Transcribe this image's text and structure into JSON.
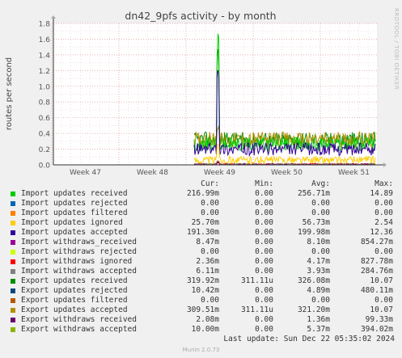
{
  "chart_data": {
    "type": "line",
    "title": "dn42_9pfs activity - by month",
    "ylabel": "routes per second",
    "ylim": [
      0,
      1.8
    ],
    "yticks": [
      "0.0",
      "0.2",
      "0.4",
      "0.6",
      "0.8",
      "1.0",
      "1.2",
      "1.4",
      "1.6",
      "1.8"
    ],
    "xticks": [
      "Week 47",
      "Week 48",
      "Week 49",
      "Week 50",
      "Week 51"
    ],
    "grid": true,
    "series": [
      {
        "name": "Import updates received",
        "color": "#00cc00",
        "level": 0.26,
        "noise": 0.09,
        "spike": 1.68
      },
      {
        "name": "Import updates rejected",
        "color": "#0066b3",
        "level": 0,
        "noise": 0,
        "spike": 0
      },
      {
        "name": "Import updates filtered",
        "color": "#ff8000",
        "level": 0,
        "noise": 0,
        "spike": 0
      },
      {
        "name": "Import updates ignored",
        "color": "#ffcc00",
        "level": 0.06,
        "noise": 0.05,
        "spike": 0.3
      },
      {
        "name": "Import updates accepted",
        "color": "#330099",
        "level": 0.2,
        "noise": 0.08,
        "spike": 1.3
      },
      {
        "name": "Import withdraws_received",
        "color": "#990099",
        "level": 0.008,
        "noise": 0.01,
        "spike": 0.05
      },
      {
        "name": "Import withdraws rejected",
        "color": "#ccff00",
        "level": 0,
        "noise": 0,
        "spike": 0
      },
      {
        "name": "Import withdraws ignored",
        "color": "#ff0000",
        "level": 0.004,
        "noise": 0.01,
        "spike": 0.04
      },
      {
        "name": "Import withdraws accepted",
        "color": "#808080",
        "level": 0.004,
        "noise": 0.006,
        "spike": 0.03
      },
      {
        "name": "Export updates received",
        "color": "#008f00",
        "level": 0.32,
        "noise": 0.1,
        "spike": 1.5
      },
      {
        "name": "Export updates rejected",
        "color": "#00487d",
        "level": 0.005,
        "noise": 0.01,
        "spike": 0.05
      },
      {
        "name": "Export updates filtered",
        "color": "#b35a00",
        "level": 0,
        "noise": 0,
        "spike": 0
      },
      {
        "name": "Export updates accepted",
        "color": "#b38f00",
        "level": 0.32,
        "noise": 0.1,
        "spike": 0.5
      },
      {
        "name": "Export withdraws received",
        "color": "#6b006b",
        "level": 0.002,
        "noise": 0.004,
        "spike": 0.03
      },
      {
        "name": "Export withdraws accepted",
        "color": "#8fb300",
        "level": 0.005,
        "noise": 0.01,
        "spike": 0.05
      }
    ]
  },
  "legend": {
    "headers": {
      "cur": "Cur:",
      "min": "Min:",
      "avg": "Avg:",
      "max": "Max:"
    },
    "rows": [
      {
        "name": "Import updates received",
        "cur": "216.99m",
        "min": "0.00",
        "avg": "256.71m",
        "max": "14.89"
      },
      {
        "name": "Import updates rejected",
        "cur": "0.00",
        "min": "0.00",
        "avg": "0.00",
        "max": "0.00"
      },
      {
        "name": "Import updates filtered",
        "cur": "0.00",
        "min": "0.00",
        "avg": "0.00",
        "max": "0.00"
      },
      {
        "name": "Import updates ignored",
        "cur": "25.70m",
        "min": "0.00",
        "avg": "56.73m",
        "max": "2.54"
      },
      {
        "name": "Import updates accepted",
        "cur": "191.30m",
        "min": "0.00",
        "avg": "199.98m",
        "max": "12.36"
      },
      {
        "name": "Import withdraws_received",
        "cur": "8.47m",
        "min": "0.00",
        "avg": "8.10m",
        "max": "854.27m"
      },
      {
        "name": "Import withdraws rejected",
        "cur": "0.00",
        "min": "0.00",
        "avg": "0.00",
        "max": "0.00"
      },
      {
        "name": "Import withdraws ignored",
        "cur": "2.36m",
        "min": "0.00",
        "avg": "4.17m",
        "max": "827.78m"
      },
      {
        "name": "Import withdraws accepted",
        "cur": "6.11m",
        "min": "0.00",
        "avg": "3.93m",
        "max": "284.76m"
      },
      {
        "name": "Export updates received",
        "cur": "319.92m",
        "min": "311.11u",
        "avg": "326.08m",
        "max": "10.07"
      },
      {
        "name": "Export updates rejected",
        "cur": "10.42m",
        "min": "0.00",
        "avg": "4.89m",
        "max": "480.11m"
      },
      {
        "name": "Export updates filtered",
        "cur": "0.00",
        "min": "0.00",
        "avg": "0.00",
        "max": "0.00"
      },
      {
        "name": "Export updates accepted",
        "cur": "309.51m",
        "min": "311.11u",
        "avg": "321.20m",
        "max": "10.07"
      },
      {
        "name": "Export withdraws received",
        "cur": "2.08m",
        "min": "0.00",
        "avg": "1.36m",
        "max": "99.33m"
      },
      {
        "name": "Export withdraws accepted",
        "cur": "10.00m",
        "min": "0.00",
        "avg": "5.37m",
        "max": "394.02m"
      }
    ],
    "last_update": "Last update: Sun Dec 22 05:35:02 2024"
  },
  "footer": "Munin 2.0.73",
  "side_label": "RRDTOOL / TOBI OETIKER"
}
